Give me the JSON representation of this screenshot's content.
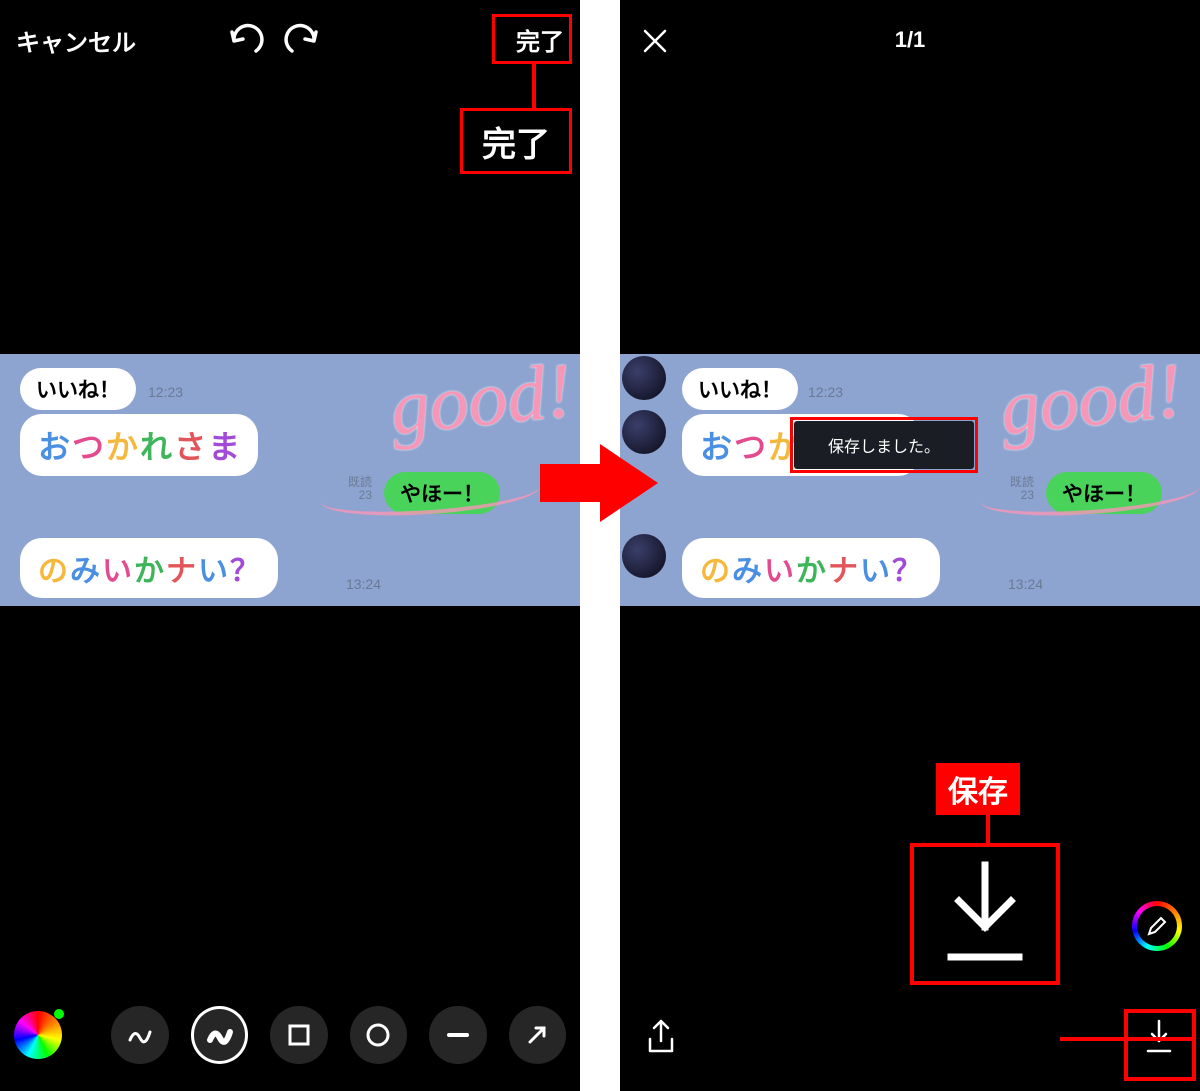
{
  "left": {
    "cancel": "キャンセル",
    "done": "完了",
    "done_callout": "完了",
    "tools": {
      "icons": [
        "color-wheel",
        "scribble-thin",
        "scribble-thick",
        "square",
        "circle",
        "line",
        "arrow"
      ]
    }
  },
  "right": {
    "counter": "1/1",
    "toast": "保存しました。",
    "save_callout": "保存"
  },
  "chat": {
    "msg1": {
      "text": "いいね！",
      "time": "12:23"
    },
    "msg2": {
      "chars": [
        "お",
        "つ",
        "か",
        "れ",
        "さ",
        "ま"
      ],
      "raw": "おつかれさま"
    },
    "msg3": {
      "text": "やほー！",
      "read": "既読",
      "time": "23"
    },
    "msg4": {
      "chars": [
        "の",
        "み",
        "い",
        "か",
        "ナ",
        "い",
        "？"
      ],
      "raw": "のみいかナい？",
      "time": "13:24"
    },
    "handwriting": "good!"
  },
  "colors": {
    "highlight": "#ff0000",
    "chat_bg": "#8ea4d0",
    "bubble_green": "#4ad35a",
    "handwriting": "#f797b8"
  }
}
